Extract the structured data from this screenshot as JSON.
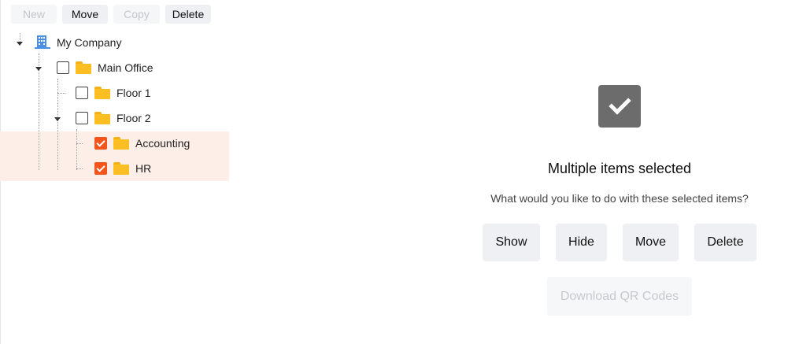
{
  "toolbar": {
    "new_label": "New",
    "move_label": "Move",
    "copy_label": "Copy",
    "delete_label": "Delete"
  },
  "tree": {
    "root": {
      "label": "My Company",
      "icon": "building-icon"
    },
    "items": [
      {
        "label": "Main Office",
        "checked": false
      },
      {
        "label": "Floor 1",
        "checked": false
      },
      {
        "label": "Floor 2",
        "checked": false
      },
      {
        "label": "Accounting",
        "checked": true
      },
      {
        "label": "HR",
        "checked": true
      }
    ]
  },
  "panel": {
    "title": "Multiple items selected",
    "subtitle": "What would you like to do with these selected items?",
    "actions": {
      "show": "Show",
      "hide": "Hide",
      "move": "Move",
      "delete": "Delete"
    },
    "download_label": "Download QR Codes"
  },
  "colors": {
    "accent": "#f2541b",
    "selection_bg": "#fdeee7",
    "folder": "#fbbf24",
    "building": "#4a8fe3"
  }
}
